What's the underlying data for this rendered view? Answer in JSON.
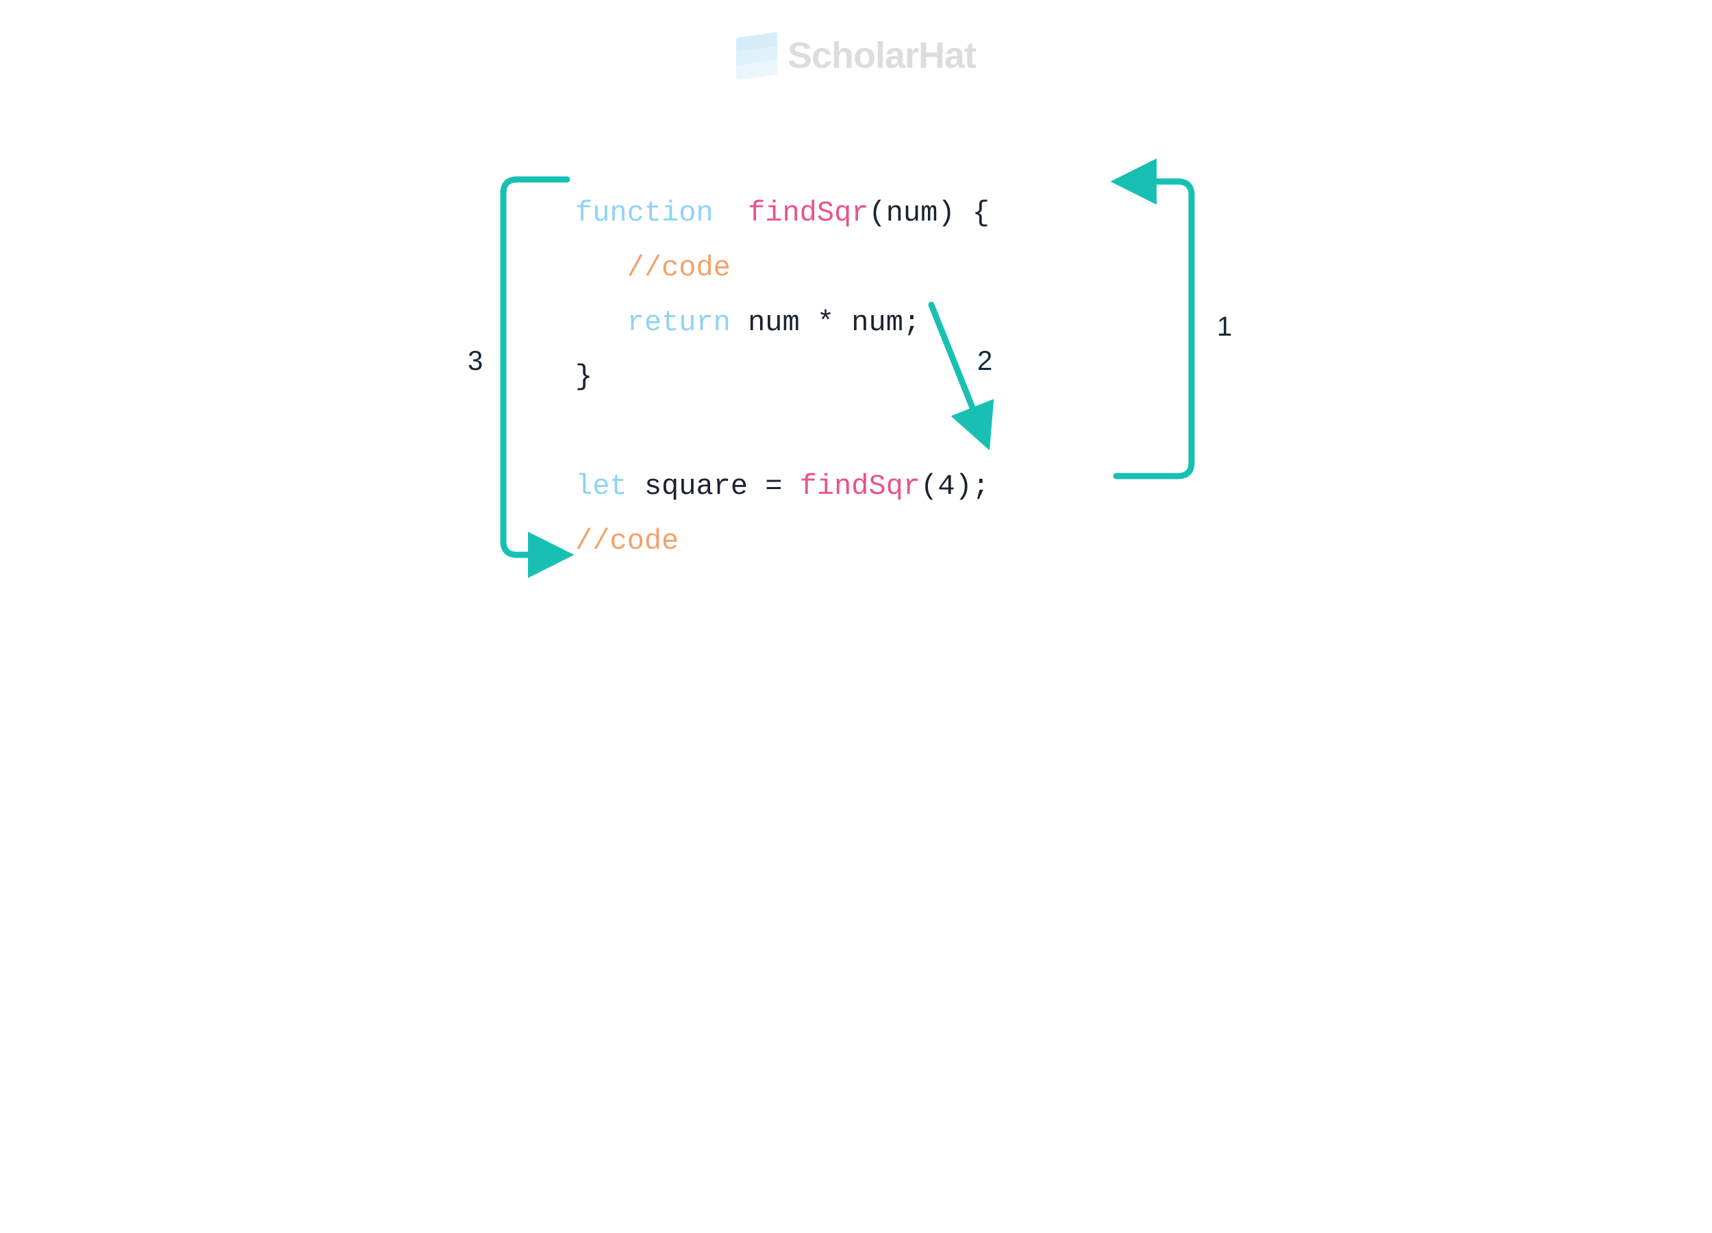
{
  "brand": "ScholarHat",
  "colors": {
    "arrow": "#18c0b4",
    "kw": "#8fd3f4",
    "fn": "#e9528e",
    "cm": "#f2a26b",
    "txt": "#1a2330"
  },
  "steps": {
    "one": "1",
    "two": "2",
    "three": "3"
  },
  "code": {
    "l1": {
      "kw_function": "function",
      "sp1": "  ",
      "fn_name": "findSqr",
      "params": "(num) {"
    },
    "l2": {
      "indent": "   ",
      "comment": "//code"
    },
    "l3": {
      "indent": "   ",
      "kw_return": "return",
      "sp": " ",
      "expr": "num * num;"
    },
    "l4": {
      "brace": "}"
    },
    "l5": {
      "empty": " "
    },
    "l6": {
      "kw_let": "let",
      "sp1": " ",
      "var": "square = ",
      "fn_call": "findSqr",
      "args": "(4);"
    },
    "l7": {
      "comment": "//code"
    }
  }
}
